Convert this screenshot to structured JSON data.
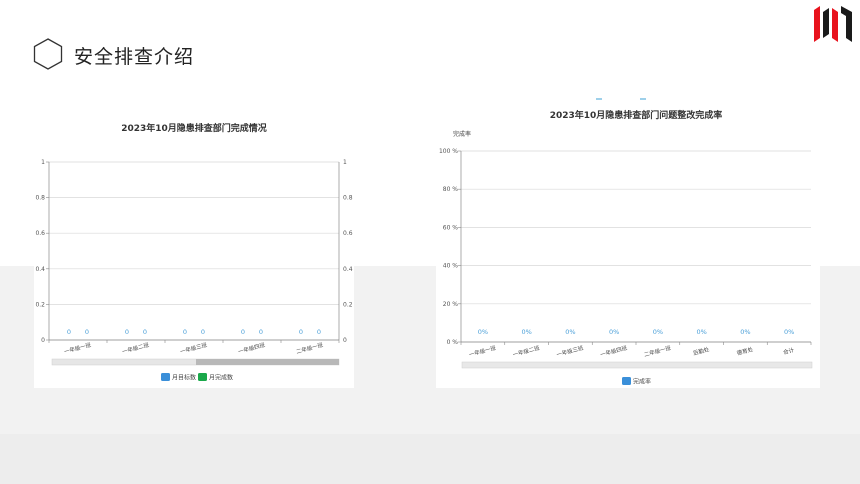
{
  "header": {
    "title": "安全排查介绍"
  },
  "colors": {
    "accent_red": "#e8131d",
    "logo_dark": "#1a1a1a",
    "series_blue": "#3a8fd9",
    "series_green": "#1aa84a",
    "grid": "#d9d9d9",
    "label": "#4a9fd8"
  },
  "chart_data": [
    {
      "type": "bar",
      "title": "2023年10月隐患排查部门完成情况",
      "categories": [
        "一年级一班",
        "一年级二班",
        "一年级三班",
        "一年级四班",
        "二年级一班"
      ],
      "series": [
        {
          "name": "月目标数",
          "values": [
            0,
            0,
            0,
            0,
            0
          ]
        },
        {
          "name": "月完成数",
          "values": [
            0,
            0,
            0,
            0,
            0
          ]
        }
      ],
      "data_labels": [
        "0",
        "0"
      ],
      "yticks": [
        "0",
        "0.2",
        "0.4",
        "0.6",
        "0.8",
        "1"
      ],
      "ylim": [
        0,
        1
      ],
      "y2ticks": [
        "0",
        "0.2",
        "0.4",
        "0.6",
        "0.8",
        "1"
      ],
      "grid": true,
      "legend": "bottom"
    },
    {
      "type": "bar",
      "title": "2023年10月隐患排查部门问题整改完成率",
      "ylabel": "完成率",
      "categories": [
        "一年级一班",
        "一年级二班",
        "一年级三班",
        "一年级四班",
        "二年级一班",
        "后勤处",
        "德育处",
        "合计"
      ],
      "series": [
        {
          "name": "完成率",
          "values": [
            0,
            0,
            0,
            0,
            0,
            0,
            0,
            0
          ]
        }
      ],
      "data_label": "0%",
      "yticks": [
        "0 %",
        "20 %",
        "40 %",
        "60 %",
        "80 %",
        "100 %"
      ],
      "ylim": [
        0,
        100
      ],
      "grid": true,
      "legend": "bottom"
    }
  ]
}
